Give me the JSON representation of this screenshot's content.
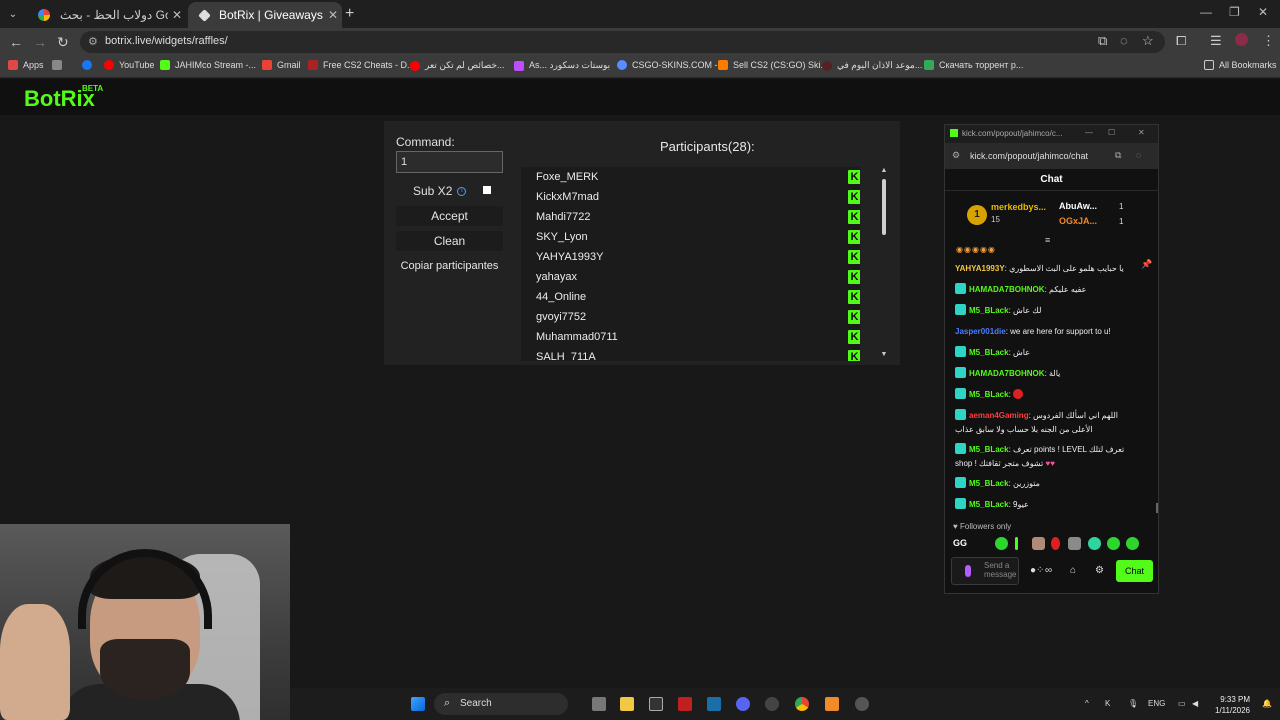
{
  "browser": {
    "tabs": [
      {
        "title": "دولاب الحظ - بحث Google",
        "active": false
      },
      {
        "title": "BotRix | Giveaways",
        "active": true
      }
    ],
    "new_tab_icon": "plus-icon",
    "url": "botrix.live/widgets/raffles/",
    "bookmarks": [
      {
        "label": "Apps",
        "color": "#e04848"
      },
      {
        "label": "",
        "color": "#888888"
      },
      {
        "label": "",
        "color": "#1877f2"
      },
      {
        "label": "YouTube",
        "color": "#ff0000"
      },
      {
        "label": "JAHIMco Stream -...",
        "color": "#53fc18"
      },
      {
        "label": "Gmail",
        "color": "#ea4335"
      },
      {
        "label": "Free CS2 Cheats - D...",
        "color": "#aa2222"
      },
      {
        "label": "خصائص لم تكن تعر...",
        "color": "#ff0000"
      },
      {
        "label": "As... بوستات دسكورد",
        "color": "#c04cff"
      },
      {
        "label": "CSGO-SKINS.COM -...",
        "color": "#5a8cff"
      },
      {
        "label": "Sell CS2 (CS:GO) Ski...",
        "color": "#ff7a00"
      },
      {
        "label": "موعد الاذان اليوم في...",
        "color": "#552222"
      },
      {
        "label": "Скачать торрент р...",
        "color": "#33aa55"
      },
      {
        "label": "All Bookmarks",
        "color": "#cccccc"
      }
    ]
  },
  "botrix": {
    "logo": "BotRix",
    "beta": "BETA",
    "command_label": "Command:",
    "command_value": "1",
    "sub_x2_label": "Sub X2",
    "sub_x2_checked": false,
    "accept_label": "Accept",
    "clean_label": "Clean",
    "copy_label": "Copiar participantes",
    "participants_title": "Participants(28):",
    "participants": [
      "Foxe_MERK",
      "KickxM7mad",
      "Mahdi7722",
      "SKY_Lyon",
      "YAHYA1993Y",
      "yahayax",
      "44_Online",
      "gvoyi7752",
      "Muhammad0711",
      "SALH_711A"
    ]
  },
  "chat_popout": {
    "window_title": "kick.com/popout/jahimco/c...",
    "url": "kick.com/popout/jahimco/chat",
    "header": "Chat",
    "leaderboard": {
      "top_rank": "1",
      "top_name": "merkedbys...",
      "top_sub": "15",
      "others": [
        {
          "name": "AbuAw...",
          "count": "1",
          "color": "#ffffff"
        },
        {
          "name": "OGxJA...",
          "count": "1",
          "color": "#f08a2a"
        }
      ]
    },
    "messages": [
      {
        "user": "YAHYA1993Y",
        "color": "#f2c744",
        "text": "يا حبايب هلمو على البث الاسطوري ",
        "badge": false
      },
      {
        "user": "HAMADA7BOHNOK",
        "color": "#53fc18",
        "text": "عفيه عليكم",
        "badge": true
      },
      {
        "user": "M5_BLack",
        "color": "#53fc18",
        "text": "لك عاش",
        "badge": true
      },
      {
        "user": "Jasper001die",
        "color": "#4a7dff",
        "text": "we are here for support to u!",
        "badge": false
      },
      {
        "user": "M5_BLack",
        "color": "#53fc18",
        "text": "عاش",
        "badge": true
      },
      {
        "user": "HAMADA7BOHNOK",
        "color": "#53fc18",
        "text": "يالة",
        "badge": true
      },
      {
        "user": "M5_BLack",
        "color": "#53fc18",
        "text": "",
        "badge": true,
        "heart": true
      },
      {
        "user": "aeman4Gaming",
        "color": "#ff3c3c",
        "text": "اللهم اني اسألك الفردوس الأعلى من الجنه بلا حساب ولا سابق عذاب",
        "badge": true
      },
      {
        "user": "M5_BLack",
        "color": "#53fc18",
        "text": "تعرف points ! LEVEL تعرف لتلك shop ! تشوف متجر ثقافتك",
        "badge": true
      },
      {
        "user": "M5_BLack",
        "color": "#53fc18",
        "text": "متوزرين",
        "badge": true
      },
      {
        "user": "M5_BLack",
        "color": "#53fc18",
        "text": "عيو9",
        "badge": true
      }
    ],
    "followers_only": "Followers only",
    "emote_gg": "GG",
    "input_placeholder": "Send a message",
    "chat_button": "Chat"
  },
  "taskbar": {
    "search_label": "Search",
    "lang": "ENG",
    "time": "9:33 PM",
    "date": "1/11/2026"
  }
}
